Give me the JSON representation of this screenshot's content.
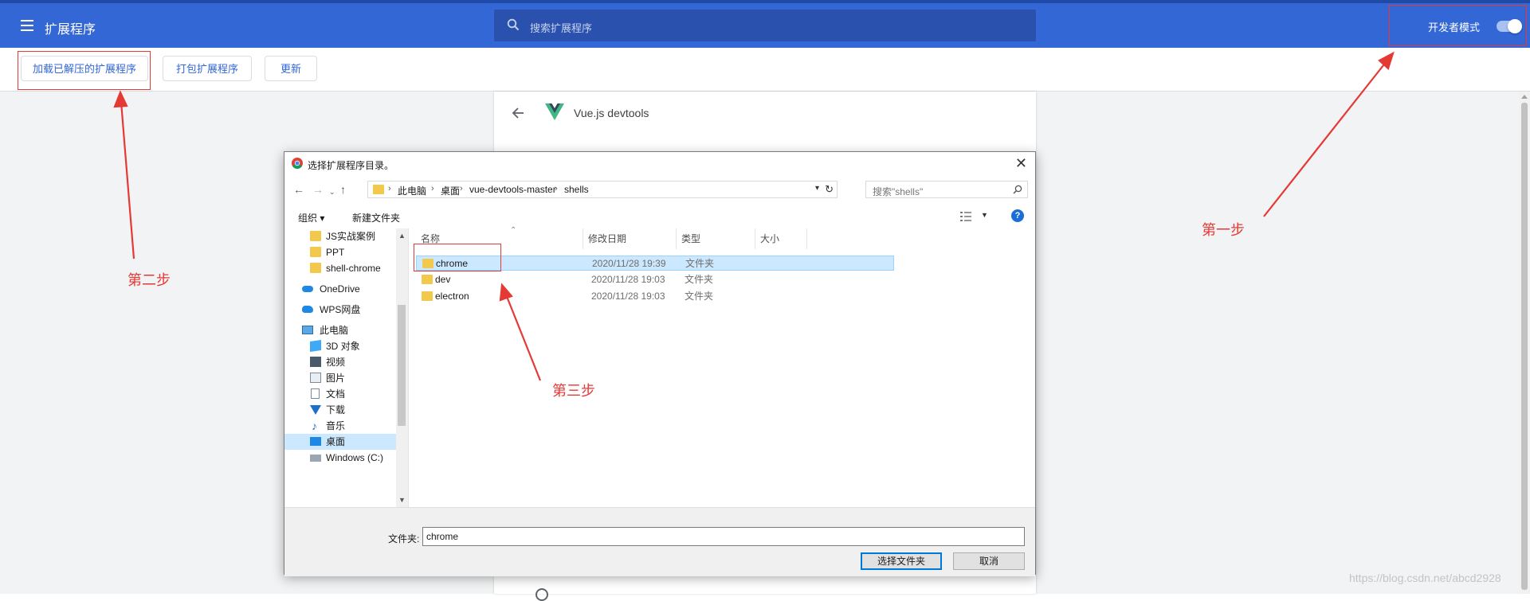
{
  "header": {
    "title": "扩展程序",
    "search_placeholder": "搜索扩展程序",
    "dev_mode_label": "开发者模式",
    "dev_mode_on": true
  },
  "toolbar": {
    "load_unpacked": "加载已解压的扩展程序",
    "pack": "打包扩展程序",
    "update": "更新"
  },
  "detail": {
    "extension_name": "Vue.js devtools"
  },
  "annotations": {
    "step1": "第一步",
    "step2": "第二步",
    "step3": "第三步",
    "color": "#e53935"
  },
  "dialog": {
    "title": "选择扩展程序目录。",
    "breadcrumbs": [
      "此电脑",
      "桌面",
      "vue-devtools-master",
      "shells"
    ],
    "search_placeholder": "搜索\"shells\"",
    "organize": "组织 ▾",
    "new_folder": "新建文件夹",
    "help": "?",
    "nav_items": [
      {
        "label": "JS实战案例",
        "icon": "folder-icon"
      },
      {
        "label": "PPT",
        "icon": "folder-icon"
      },
      {
        "label": "shell-chrome",
        "icon": "folder-icon"
      },
      {
        "label": "OneDrive",
        "icon": "onedrive-icon"
      },
      {
        "label": "WPS网盘",
        "icon": "wps-cloud-icon"
      },
      {
        "label": "此电脑",
        "icon": "computer-icon"
      },
      {
        "label": "3D 对象",
        "icon": "3d-objects-icon"
      },
      {
        "label": "视频",
        "icon": "video-icon"
      },
      {
        "label": "图片",
        "icon": "pictures-icon"
      },
      {
        "label": "文档",
        "icon": "documents-icon"
      },
      {
        "label": "下载",
        "icon": "download-icon"
      },
      {
        "label": "音乐",
        "icon": "music-icon"
      },
      {
        "label": "桌面",
        "icon": "desktop-icon",
        "selected": true
      },
      {
        "label": "Windows (C:)",
        "icon": "drive-icon"
      }
    ],
    "columns": [
      "名称",
      "修改日期",
      "类型",
      "大小"
    ],
    "files": [
      {
        "name": "chrome",
        "date": "2020/11/28 19:39",
        "type": "文件夹",
        "selected": true
      },
      {
        "name": "dev",
        "date": "2020/11/28 19:03",
        "type": "文件夹"
      },
      {
        "name": "electron",
        "date": "2020/11/28 19:03",
        "type": "文件夹"
      }
    ],
    "folder_label": "文件夹:",
    "folder_value": "chrome",
    "select_button": "选择文件夹",
    "cancel_button": "取消"
  },
  "watermark": "https://blog.csdn.net/abcd2928",
  "colors": {
    "header_bg": "#3367d6",
    "accent": "#3367d6",
    "selection": "#cce8ff"
  }
}
